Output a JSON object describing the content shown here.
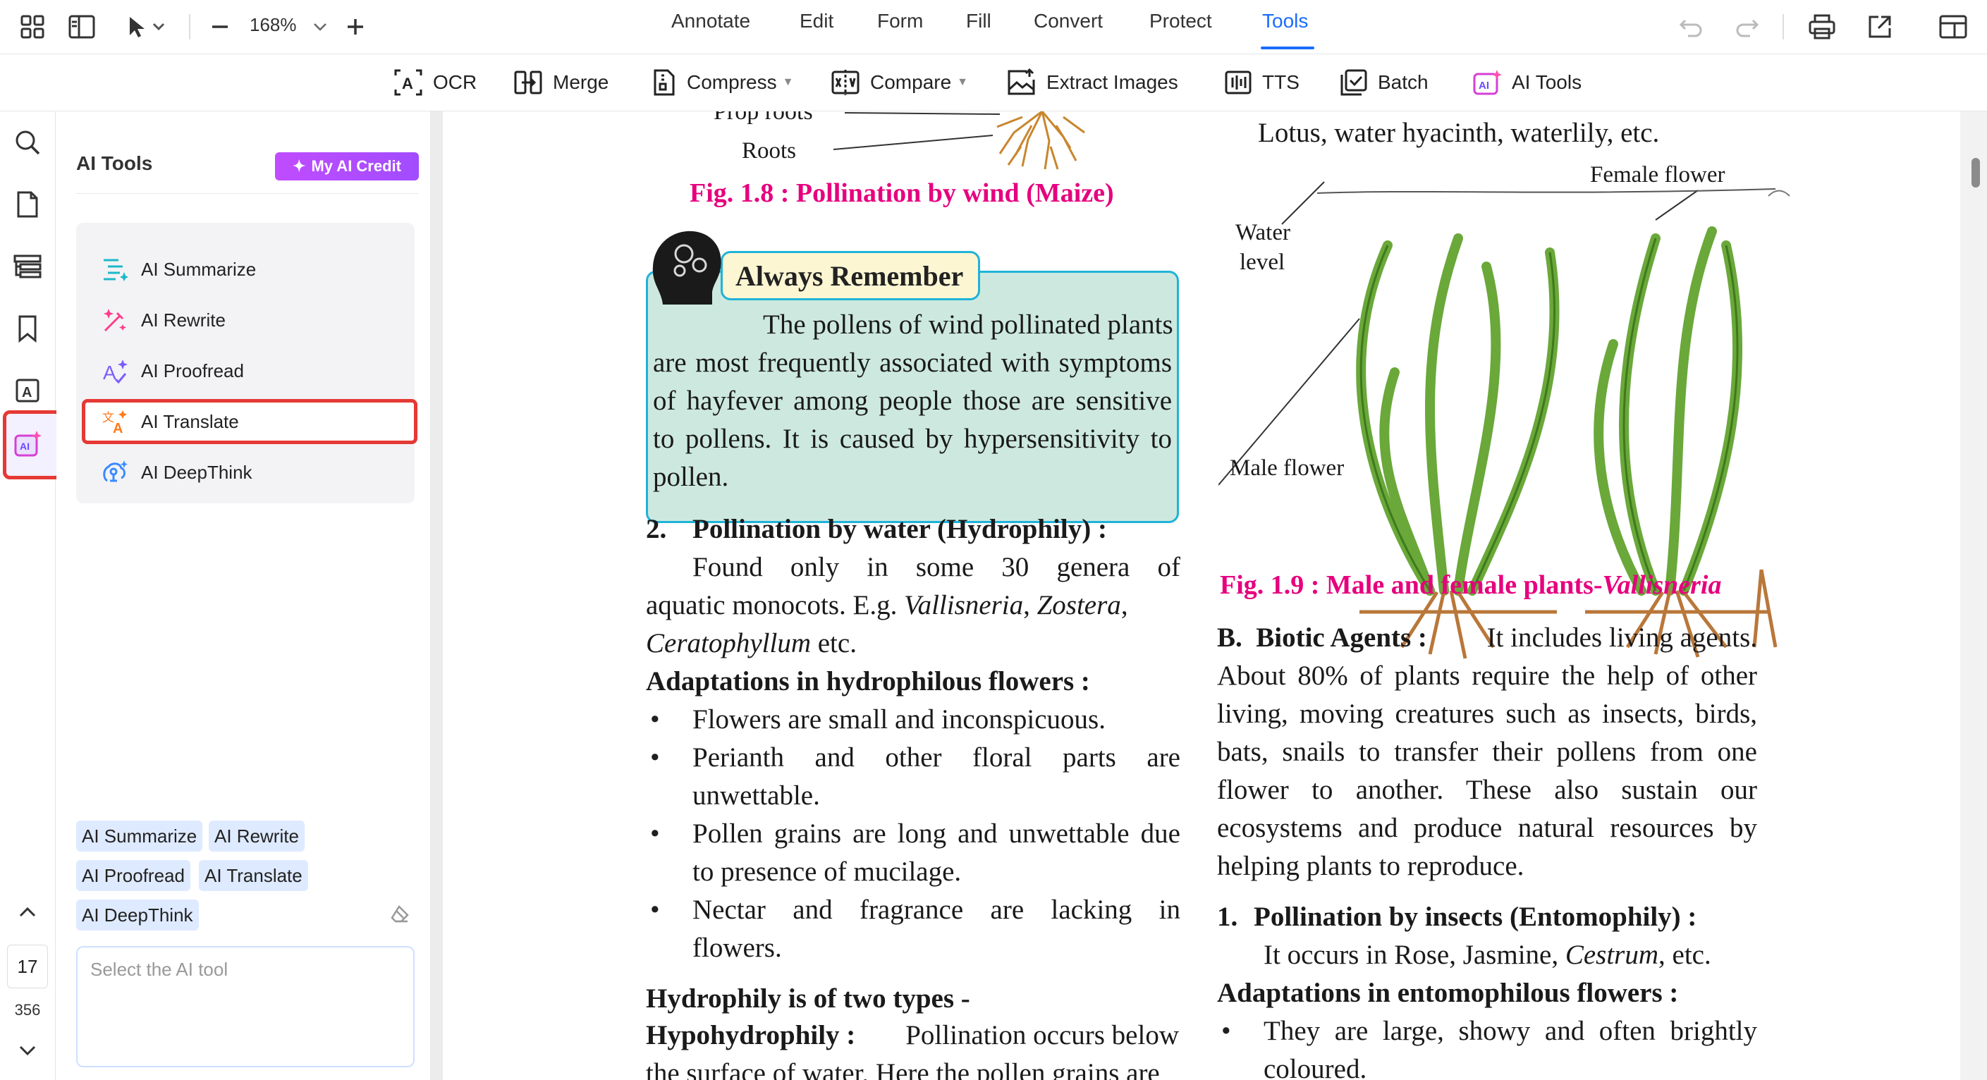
{
  "topbar": {
    "zoom": "168%",
    "menu": [
      "Annotate",
      "Edit",
      "Form",
      "Fill",
      "Convert",
      "Protect",
      "Tools"
    ],
    "active_menu": "Tools"
  },
  "toolbar": {
    "items": [
      {
        "label": "OCR",
        "icon": "ocr-icon"
      },
      {
        "label": "Merge",
        "icon": "merge-icon"
      },
      {
        "label": "Compress",
        "icon": "compress-icon",
        "dropdown": true
      },
      {
        "label": "Compare",
        "icon": "compare-icon",
        "dropdown": true
      },
      {
        "label": "Extract Images",
        "icon": "extract-images-icon"
      },
      {
        "label": "TTS",
        "icon": "tts-icon"
      },
      {
        "label": "Batch",
        "icon": "batch-icon"
      },
      {
        "label": "AI Tools",
        "icon": "ai-tools-icon"
      }
    ]
  },
  "rail": {
    "page_number": "17",
    "total_pages": "356"
  },
  "ai_panel": {
    "title": "AI Tools",
    "credit_button": "My AI Credit",
    "tools": [
      {
        "label": "AI Summarize",
        "icon": "summarize-icon"
      },
      {
        "label": "AI Rewrite",
        "icon": "rewrite-icon"
      },
      {
        "label": "AI Proofread",
        "icon": "proofread-icon"
      },
      {
        "label": "AI Translate",
        "icon": "translate-icon",
        "selected": true
      },
      {
        "label": "AI DeepThink",
        "icon": "deepthink-icon"
      }
    ],
    "chips": [
      "AI Summarize",
      "AI Rewrite",
      "AI Proofread",
      "AI Translate",
      "AI DeepThink"
    ],
    "input_placeholder": "Select the AI tool"
  },
  "document": {
    "left": {
      "prop_roots": "Prop roots",
      "roots": "Roots",
      "fig18": "Fig. 1.8 : Pollination by wind (Maize)",
      "remember_title": "Always Remember",
      "remember_lines": [
        "The pollens of wind pollinated plants",
        "are most frequently associated with symptoms",
        "of hayfever among people those are sensitive",
        "to pollens. It is caused by hypersensitivity to",
        "pollen."
      ],
      "h2_num": "2.",
      "h2_text": "Pollination by water (Hydrophily) :",
      "p1": "Found only in some 30 genera of",
      "p2_a": "aquatic monocots. E.g. ",
      "p2_b": "Vallisneria",
      "p2_c": ", ",
      "p2_d": "Zostera",
      "p2_e": ",",
      "p3_a": "Ceratophyllum",
      "p3_b": " etc.",
      "adapt_heading": "Adaptations in hydrophilous flowers :",
      "bullets": [
        "Flowers are small and inconspicuous.",
        "Perianth and other floral parts are",
        "unwettable.",
        "Pollen grains are long and unwettable due",
        "to presence of mucilage.",
        "Nectar and fragrance are lacking in",
        "flowers."
      ],
      "types_heading": "Hydrophily is of two types -",
      "hypo_label": "Hypohydrophily :",
      "hypo_text": "Pollination occurs below",
      "hypo_next": "the surface of water. Here the pollen grains are"
    },
    "right": {
      "lotus": "Lotus, water hyacinth, waterlily, etc.",
      "female_flower": "Female flower",
      "water": "Water",
      "level": "level",
      "male_flower": "Male flower",
      "fig19_a": "Fig. 1.9 : Male and female plants-",
      "fig19_b": "Vallisneria",
      "biotic_label": "B.",
      "biotic_head": "Biotic Agents :",
      "biotic_first": "It includes living agents.",
      "biotic_lines": [
        "About 80% of plants require the help of other",
        "living, moving creatures such as insects, birds,",
        "bats, snails to transfer their pollens from one",
        "flower to another. These also sustain our",
        "ecosystems and produce natural resources by"
      ],
      "biotic_last": "helping plants to reproduce.",
      "h1_num": "1.",
      "h1_text": "Pollination by insects (Entomophily) :",
      "ent_a": "It occurs in Rose, Jasmine, ",
      "ent_b": "Cestrum",
      "ent_c": ", etc.",
      "ento_heading": "Adaptations in entomophilous flowers :",
      "ento_b1": "They are large, showy and often brightly",
      "ento_b1_cont": "coloured."
    }
  },
  "colors": {
    "accent": "#1a6cff",
    "highlight_red": "#e53935",
    "figure_caption": "#e6007e",
    "remember_bg": "#cde9df",
    "remember_border": "#1fb3d8",
    "plant_green": "#6aa83a",
    "root_brown": "#b9773a"
  }
}
